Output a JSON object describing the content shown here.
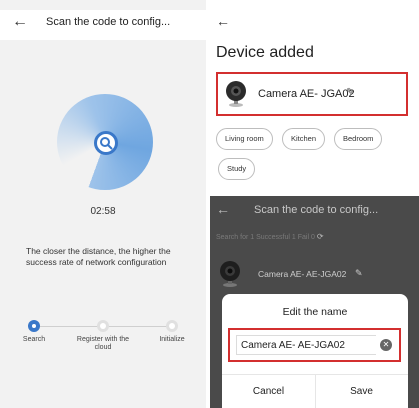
{
  "left": {
    "title": "Scan the code to config...",
    "timer": "02:58",
    "hint": "The closer the distance, the higher the success rate of network configuration",
    "steps": [
      {
        "label": "Search"
      },
      {
        "label": "Register with the cloud"
      },
      {
        "label": "Initialize"
      }
    ]
  },
  "added": {
    "heading": "Device added",
    "device_name": "Camera AE- JGA02",
    "rooms": [
      "Living room",
      "Kitchen",
      "Bedroom",
      "Study"
    ]
  },
  "edit": {
    "title": "Scan the code to config...",
    "status_label": "Search for 1",
    "status_success": "Successful 1",
    "status_fail": "Fail 0",
    "device_name": "Camera AE- AE-JGA02",
    "dialog_title": "Edit the name",
    "field_value": "Camera AE- AE-JGA02",
    "cancel_label": "Cancel",
    "save_label": "Save"
  },
  "colors": {
    "accent": "#3a78c9",
    "highlight": "#d32f2f"
  }
}
